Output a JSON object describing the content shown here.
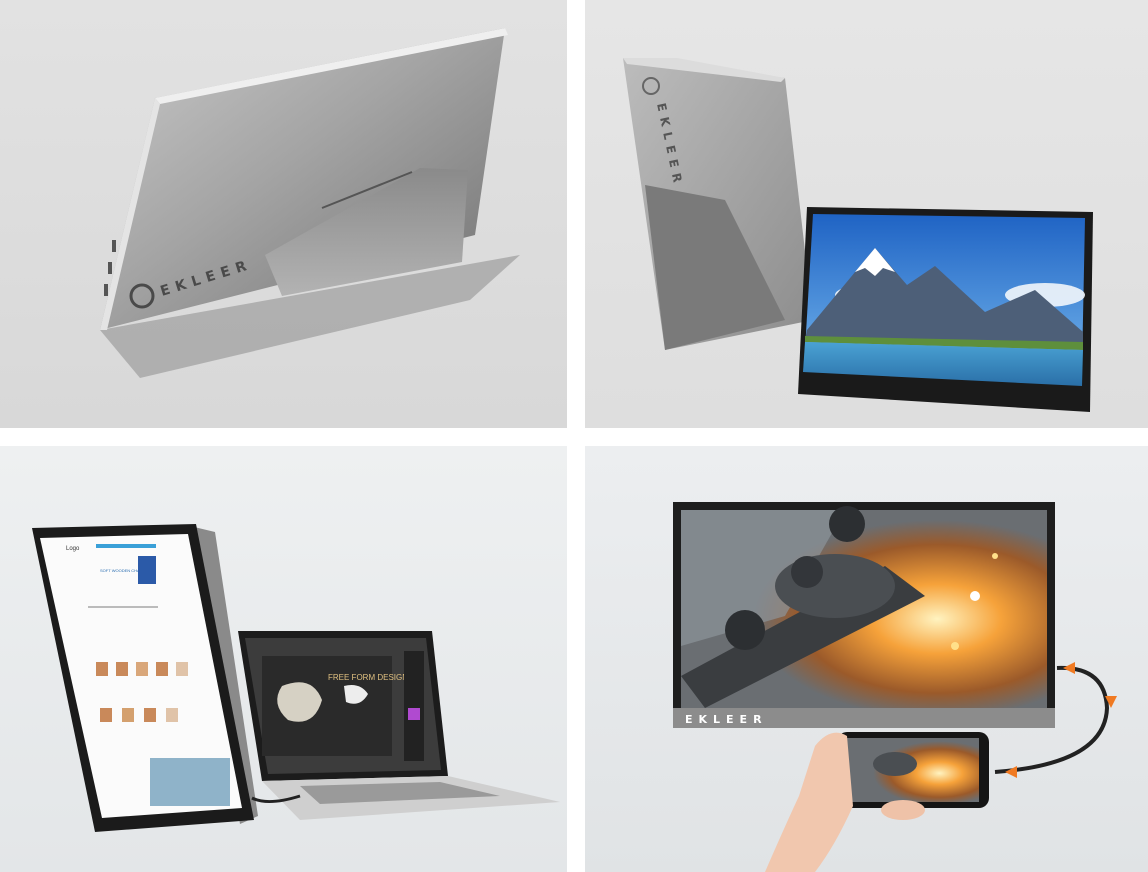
{
  "panels": [
    {
      "id": "panel-rear-kickstand",
      "brand_text": "EKLEER"
    },
    {
      "id": "panel-front-and-back",
      "brand_text": "EKLEER"
    },
    {
      "id": "panel-monitor-with-laptop",
      "website_logo": "Logo",
      "product_banner": "SOFT WOODEN CHAIR",
      "design_title": "FREE FORM DESIGN"
    },
    {
      "id": "panel-phone-connection",
      "brand_text": "EKLEER"
    }
  ],
  "colors": {
    "sky": "#2f7fd6",
    "water": "#3f95c8",
    "spark": "#f6a23a",
    "cable_arrow": "#f07a22"
  }
}
